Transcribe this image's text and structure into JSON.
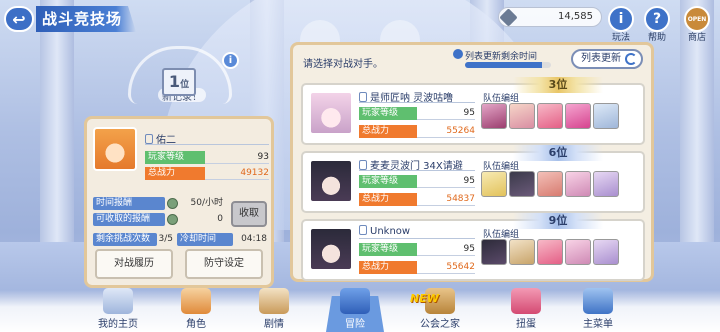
{
  "header": {
    "back_icon": "↩",
    "title": "战斗竞技场",
    "currency": "14,585",
    "buttons": [
      {
        "icon": "i",
        "label": "玩法"
      },
      {
        "icon": "?",
        "label": "帮助"
      },
      {
        "icon": "OPEN",
        "label": "商店"
      }
    ]
  },
  "record": {
    "label": "新记录！",
    "rank": "1",
    "rank_unit": "位",
    "info_icon": "i"
  },
  "player": {
    "name": "佑二",
    "level_label": "玩家等级",
    "level": "93",
    "power_label": "总战力",
    "power": "49132",
    "time_reward_label": "时间报酬",
    "time_reward_value": "50/小时",
    "claimable_label": "可收取的报酬",
    "claimable_value": "0",
    "collect_button": "收取",
    "remaining_label": "剩余挑战次数",
    "remaining_value": "3/5",
    "cooldown_label": "冷却时间",
    "cooldown_value": "04:18",
    "history_button": "对战履历",
    "defense_button": "防守设定"
  },
  "opponents_panel": {
    "prompt": "请选择对战对手。",
    "timer_label": "列表更新剩余时间",
    "timer_progress": 0.9,
    "refresh_button": "列表更新",
    "team_label": "队伍编组",
    "level_label": "玩家等级",
    "power_label": "总战力"
  },
  "opponents": [
    {
      "rank": "3位",
      "name": "是师匠呐 灵波咕噜",
      "level": "95",
      "power": "55264"
    },
    {
      "rank": "6位",
      "name": "麦麦灵波门 34X请避",
      "level": "95",
      "power": "54837"
    },
    {
      "rank": "9位",
      "name": "Unknow",
      "level": "95",
      "power": "55642"
    }
  ],
  "nav": {
    "items": [
      "我的主页",
      "角色",
      "剧情",
      "冒险",
      "公会之家",
      "扭蛋",
      "主菜单"
    ],
    "new_badge": "NEW"
  }
}
